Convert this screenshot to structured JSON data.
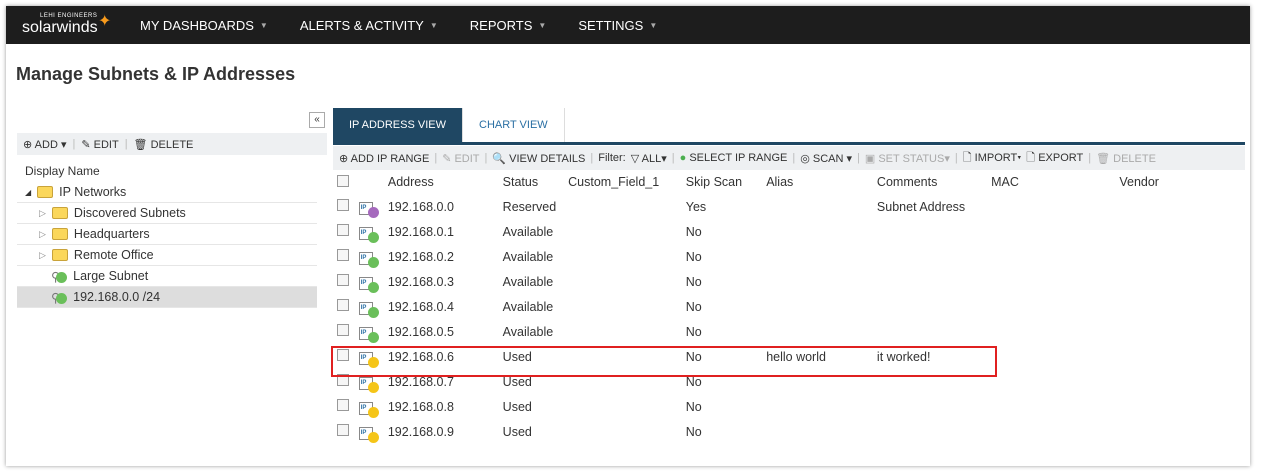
{
  "nav": {
    "logo_small": "LEHI ENGINEERS",
    "logo": "solarwinds",
    "items": [
      "MY DASHBOARDS",
      "ALERTS & ACTIVITY",
      "REPORTS",
      "SETTINGS"
    ]
  },
  "page_title": "Manage Subnets & IP Addresses",
  "left": {
    "toolbar": {
      "add": "ADD",
      "edit": "EDIT",
      "delete": "DELETE"
    },
    "column": "Display Name",
    "tree": [
      {
        "label": "IP Networks",
        "type": "root"
      },
      {
        "label": "Discovered Subnets",
        "type": "folder"
      },
      {
        "label": "Headquarters",
        "type": "folder"
      },
      {
        "label": "Remote Office",
        "type": "folder"
      },
      {
        "label": "Large Subnet",
        "type": "subnet"
      },
      {
        "label": "192.168.0.0 /24",
        "type": "subnet",
        "selected": true
      }
    ]
  },
  "tabs": [
    "IP ADDRESS VIEW",
    "CHART VIEW"
  ],
  "toolbar": {
    "add_range": "ADD IP RANGE",
    "edit": "EDIT",
    "view_details": "VIEW DETAILS",
    "filter": "Filter:",
    "all": "ALL",
    "select_range": "SELECT IP RANGE",
    "scan": "SCAN",
    "set_status": "SET STATUS",
    "import": "IMPORT",
    "export": "EXPORT",
    "delete": "DELETE"
  },
  "columns": [
    "Address",
    "Status",
    "Custom_Field_1",
    "Skip Scan",
    "Alias",
    "Comments",
    "MAC",
    "Vendor"
  ],
  "colors": {
    "Reserved": "#a569bd",
    "Available": "#6abf5a",
    "Used": "#f5c518",
    "nav": "#1d1d1d",
    "tab": "#1f4763"
  },
  "rows": [
    [
      "192.168.0.0",
      "Reserved",
      "",
      "Yes",
      "",
      "Subnet Address",
      "",
      ""
    ],
    [
      "192.168.0.1",
      "Available",
      "",
      "No",
      "",
      "",
      "",
      ""
    ],
    [
      "192.168.0.2",
      "Available",
      "",
      "No",
      "",
      "",
      "",
      ""
    ],
    [
      "192.168.0.3",
      "Available",
      "",
      "No",
      "",
      "",
      "",
      ""
    ],
    [
      "192.168.0.4",
      "Available",
      "",
      "No",
      "",
      "",
      "",
      ""
    ],
    [
      "192.168.0.5",
      "Available",
      "",
      "No",
      "",
      "",
      "",
      ""
    ],
    [
      "192.168.0.6",
      "Used",
      "",
      "No",
      "hello world",
      "it worked!",
      "",
      ""
    ],
    [
      "192.168.0.7",
      "Used",
      "",
      "No",
      "",
      "",
      "",
      ""
    ],
    [
      "192.168.0.8",
      "Used",
      "",
      "No",
      "",
      "",
      "",
      ""
    ],
    [
      "192.168.0.9",
      "Used",
      "",
      "No",
      "",
      "",
      "",
      ""
    ]
  ]
}
